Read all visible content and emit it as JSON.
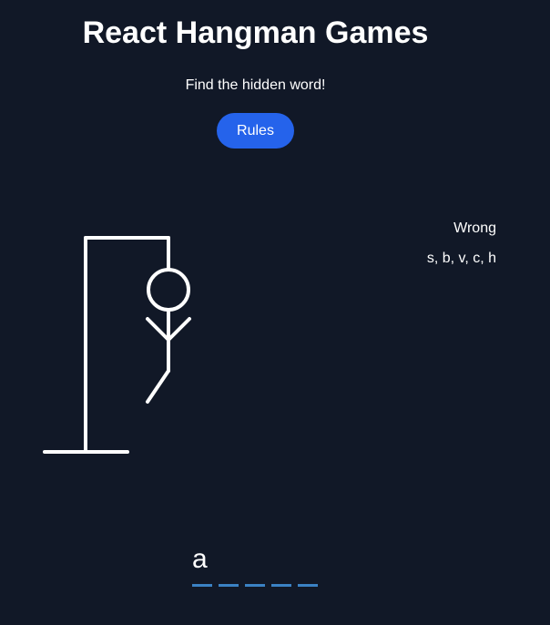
{
  "header": {
    "title": "React Hangman Games",
    "subtitle": "Find the hidden word!",
    "rules_label": "Rules"
  },
  "wrong": {
    "label": "Wrong",
    "letters": "s, b, v, c, h"
  },
  "word": {
    "slots": [
      "a",
      "",
      "",
      "",
      ""
    ]
  },
  "hangman": {
    "parts_shown": [
      "head",
      "body",
      "left-arm",
      "right-arm",
      "left-leg"
    ]
  },
  "colors": {
    "background": "#111827",
    "button": "#2563eb",
    "underline": "#3b82c4",
    "text": "#ffffff"
  }
}
